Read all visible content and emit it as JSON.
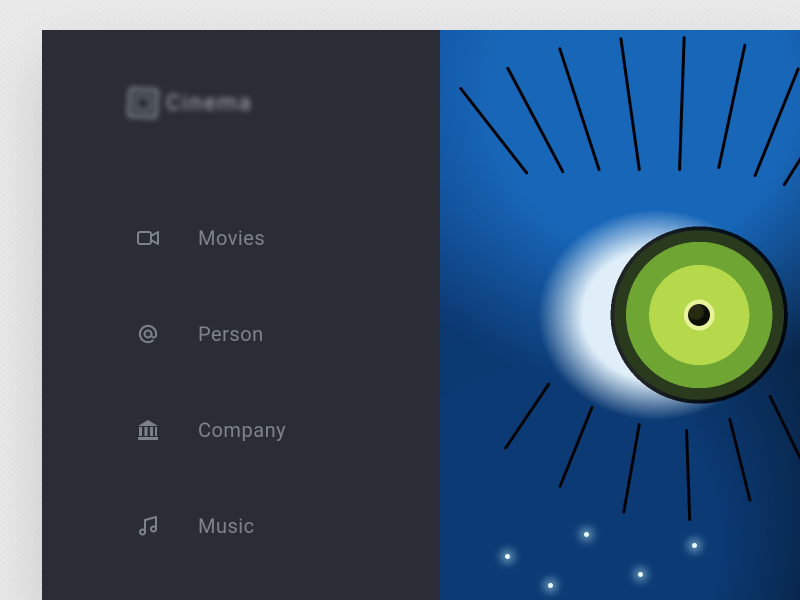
{
  "brand": {
    "name": "Cinema"
  },
  "sidebar": {
    "items": [
      {
        "label": "Movies",
        "icon": "video-camera-icon"
      },
      {
        "label": "Person",
        "icon": "at-sign-icon"
      },
      {
        "label": "Company",
        "icon": "bank-icon"
      },
      {
        "label": "Music",
        "icon": "music-note-icon"
      }
    ]
  },
  "main": {
    "hero_image": "avatar-navi-eye-closeup"
  },
  "colors": {
    "sidebar_bg": "#2a2d35",
    "text_muted": "#7d838d",
    "hero_blue": "#0f4b9a",
    "iris_green": "#b6d94b"
  }
}
